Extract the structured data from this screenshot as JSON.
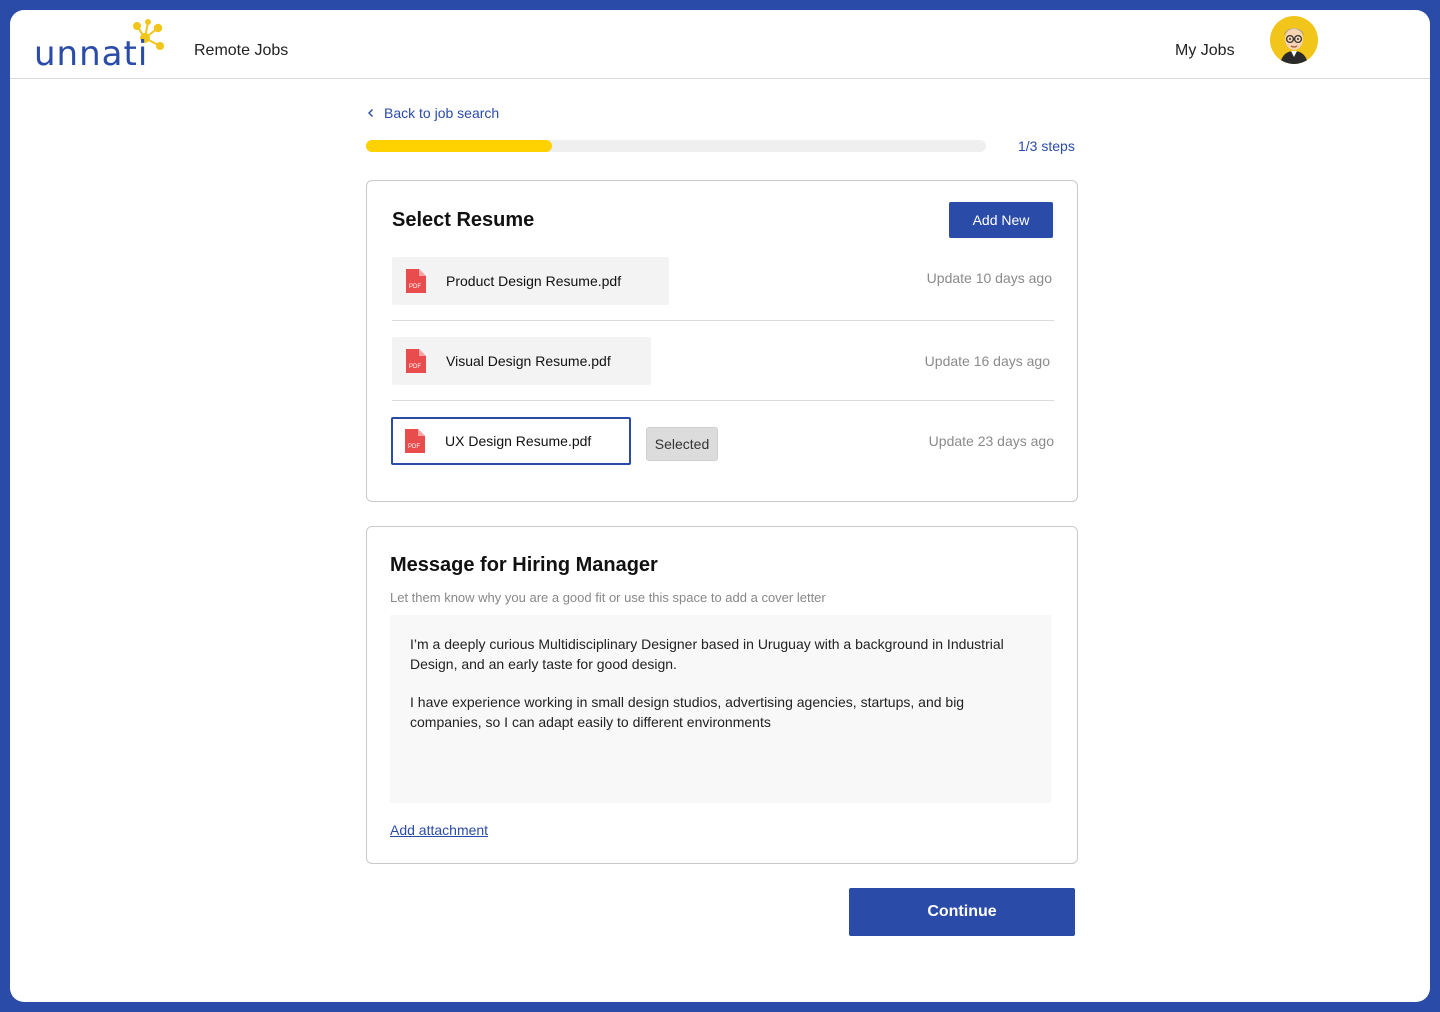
{
  "header": {
    "logo_text": "unnati",
    "nav_remote_jobs": "Remote Jobs",
    "nav_my_jobs": "My Jobs"
  },
  "progress": {
    "back_label": "Back to job search",
    "steps_label": "1/3 steps",
    "fraction": 0.3
  },
  "resume": {
    "title": "Select Resume",
    "add_new_label": "Add New",
    "items": [
      {
        "file": "Product Design Resume.pdf",
        "updated": "Update 10 days ago",
        "selected": false
      },
      {
        "file": "Visual Design Resume.pdf",
        "updated": "Update 16 days ago",
        "selected": false
      },
      {
        "file": "UX Design Resume.pdf",
        "updated": "Update 23 days ago",
        "selected": true
      }
    ],
    "selected_badge": "Selected",
    "pdf_icon_label": "PDF"
  },
  "message": {
    "title": "Message for Hiring Manager",
    "subtitle": "Let them know why you are a good fit or use this space to add a cover letter",
    "paragraph_1": "I’m a deeply curious Multidisciplinary Designer based in Uruguay with a background in Industrial Design, and an early taste for good design.",
    "paragraph_2": "I have experience working in small design studios, advertising agencies, startups, and big companies, so I can adapt easily to different environments",
    "attachment_label": "Add attachment"
  },
  "footer": {
    "continue_label": "Continue"
  },
  "colors": {
    "brand": "#2a4ba8",
    "accent_yellow": "#fdd200",
    "pdf_red": "#e84c4c"
  }
}
